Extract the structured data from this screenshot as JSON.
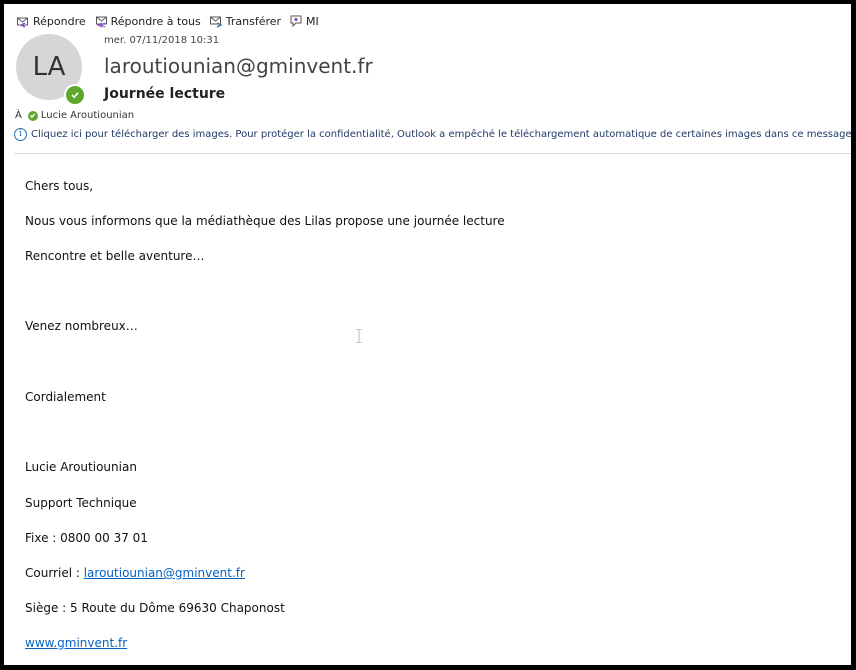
{
  "toolbar": {
    "reply": "Répondre",
    "reply_all": "Répondre à tous",
    "forward": "Transférer",
    "im": "MI"
  },
  "header": {
    "date": "mer. 07/11/2018 10:31",
    "avatar_initials": "LA",
    "sender": "laroutiounian@gminvent.fr",
    "subject": "Journée lecture",
    "to_label": "À",
    "to_name": "Lucie Aroutiounian",
    "info_message": "Cliquez ici pour télécharger des images. Pour protéger la confidentialité, Outlook a empêché le téléchargement automatique de certaines images dans ce message."
  },
  "body": {
    "greeting": "Chers tous,",
    "line1": "Nous vous informons que la médiathèque des Lilas propose une journée lecture",
    "line2": "Rencontre et belle aventure…",
    "line3": "Venez nombreux…",
    "closing": "Cordialement",
    "sig_name": "Lucie Aroutiounian",
    "sig_role": "Support Technique",
    "sig_phone": "Fixe : 0800 00 37 01",
    "sig_email_label": "Courriel : ",
    "sig_email": "laroutiounian@gminvent.fr",
    "sig_address": "Siège : 5  Route du Dôme 69630 Chaponost",
    "sig_website": "www.gminvent.fr"
  },
  "colors": {
    "presence": "#5ea72d",
    "link": "#0563c1",
    "info": "#2a6fb5"
  }
}
